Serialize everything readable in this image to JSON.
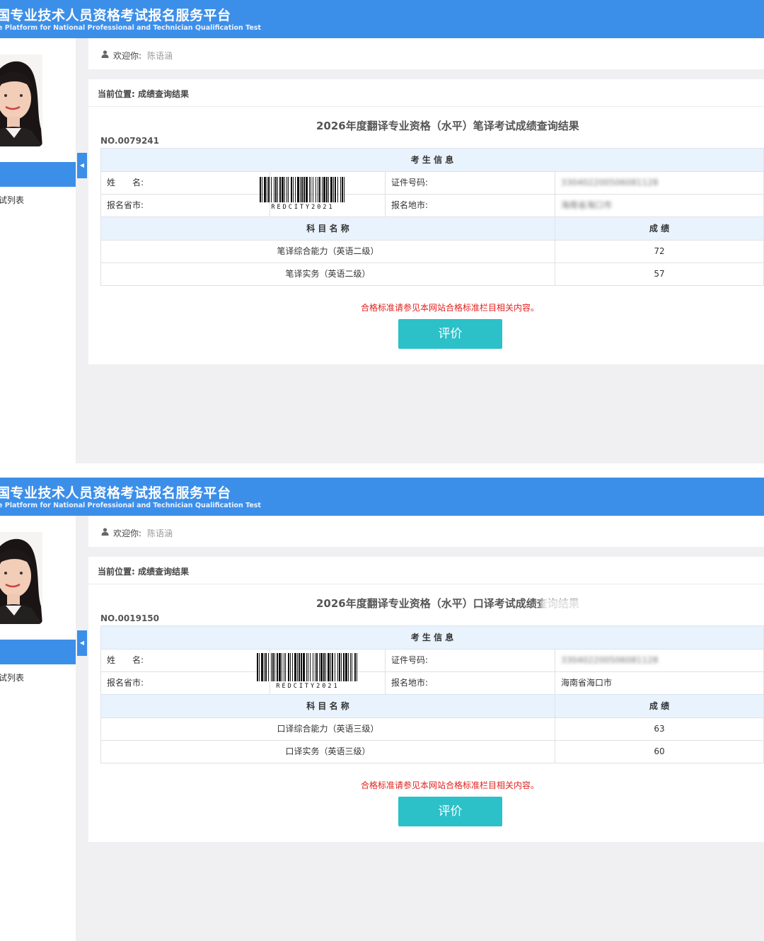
{
  "panels": [
    {
      "header": {
        "title": "国专业技术人员资格考试报名服务平台",
        "subtitle": "e Platform for National Professional and Technician Qualification Test"
      },
      "sidebar": {
        "menu_item": "试列表",
        "toggle_icon": "◀"
      },
      "welcome": {
        "label": "欢迎你:",
        "name": "陈语涵"
      },
      "breadcrumb": "当前位置: 成绩查询结果",
      "result_title": "2026年度翻译专业资格（水平）笔译考试成绩查询结果",
      "record_no": "NO.0079241",
      "info_header": "考 生 信 息",
      "name_label": "姓　　名:",
      "province_label": "报名省市:",
      "id_label": "证件号码:",
      "region_label": "报名地市:",
      "id_value": "330402200506081128",
      "region_value": "海南省海口市",
      "barcode_text": "REDCITY2021",
      "subject_header": "科 目 名 称",
      "score_header": "成 绩",
      "subjects": [
        {
          "name": "笔译综合能力（英语二级）",
          "score": "72"
        },
        {
          "name": "笔译实务（英语二级）",
          "score": "57"
        }
      ],
      "notice": "合格标准请参见本网站合格标准栏目相关内容。",
      "evaluate_button": "评价"
    },
    {
      "header": {
        "title": "国专业技术人员资格考试报名服务平台",
        "subtitle": "e Platform for National Professional and Technician Qualification Test"
      },
      "sidebar": {
        "menu_item": "试列表",
        "toggle_icon": "◀"
      },
      "welcome": {
        "label": "欢迎你:",
        "name": "陈语涵"
      },
      "breadcrumb": "当前位置: 成绩查询结果",
      "result_title": "2026年度翻译专业资格（水平）口译考试成绩查询结果",
      "record_no": "NO.0019150",
      "info_header": "考 生 信 息",
      "name_label": "姓　　名:",
      "province_label": "报名省市:",
      "id_label": "证件号码:",
      "region_label": "报名地市:",
      "id_value": "330402200506081128",
      "region_value": "海南省海口市",
      "barcode_text": "REDCITY2021",
      "subject_header": "科 目 名 称",
      "score_header": "成 绩",
      "subjects": [
        {
          "name": "口译综合能力（英语三级）",
          "score": "63"
        },
        {
          "name": "口译实务（英语三级）",
          "score": "60"
        }
      ],
      "notice": "合格标准请参见本网站合格标准栏目相关内容。",
      "evaluate_button": "评价"
    }
  ],
  "colors": {
    "header_blue": "#3c8fe9",
    "button_teal": "#2cc0c8",
    "notice_red": "#e0221e",
    "table_header_bg": "#e9f3fd",
    "content_bg": "#f0f0f2"
  },
  "icons": {
    "user": "user-icon",
    "toggle": "collapse-arrow-icon",
    "barcode": "barcode-icon",
    "photo": "avatar"
  }
}
